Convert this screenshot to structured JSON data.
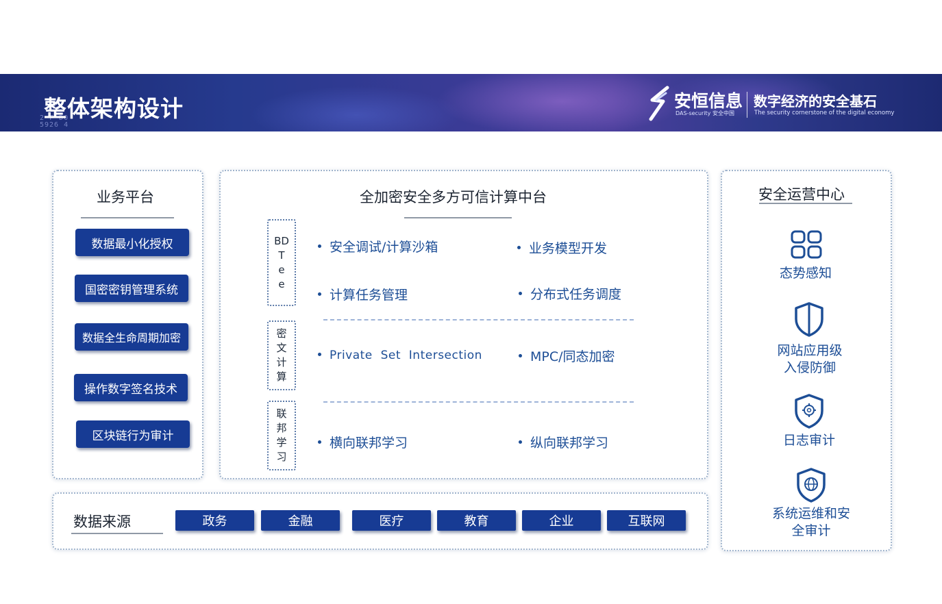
{
  "header": {
    "title": "整体架构设计",
    "deco_text": "2 F D0\n5926 4",
    "logo_name": "安恒信息",
    "logo_sub": "DAS-security 安全中国",
    "slogan": "数字经济的安全基石",
    "slogan_en": "The security cornerstone of the digital economy"
  },
  "business_platform": {
    "title": "业务平台",
    "items": [
      "数据最小化授权",
      "国密密钥管理系统",
      "数据全生命周期加密",
      "操作数字签名技术",
      "区块链行为审计"
    ]
  },
  "compute_platform": {
    "title": "全加密安全多方可信计算中台",
    "groups": [
      {
        "label": [
          "BD",
          "T",
          "e",
          "e"
        ],
        "left": [
          "安全调试/计算沙箱",
          "计算任务管理"
        ],
        "right": [
          "业务模型开发",
          "分布式任务调度"
        ]
      },
      {
        "label": [
          "密",
          "文",
          "计",
          "算"
        ],
        "left": [
          "Private  Set  Intersection"
        ],
        "right": [
          "MPC/同态加密"
        ]
      },
      {
        "label": [
          "联",
          "邦",
          "学",
          "习"
        ],
        "left": [
          "横向联邦学习"
        ],
        "right": [
          "纵向联邦学习"
        ]
      }
    ]
  },
  "security_center": {
    "title": "安全运营中心",
    "items": [
      {
        "icon": "grid-icon",
        "lines": [
          "态势感知"
        ]
      },
      {
        "icon": "shield-icon",
        "lines": [
          "网站应用级",
          "入侵防御"
        ]
      },
      {
        "icon": "gear-shield-icon",
        "lines": [
          "日志审计"
        ]
      },
      {
        "icon": "globe-shield-icon",
        "lines": [
          "系统运维和安",
          "全审计"
        ]
      }
    ]
  },
  "data_sources": {
    "title": "数据来源",
    "items": [
      "政务",
      "金融",
      "医疗",
      "教育",
      "企业",
      "互联网"
    ]
  },
  "colors": {
    "banner": "#263a8e",
    "button": "#173b94",
    "accent_text": "#1d4e96",
    "panel_border": "#9fb3cc"
  }
}
